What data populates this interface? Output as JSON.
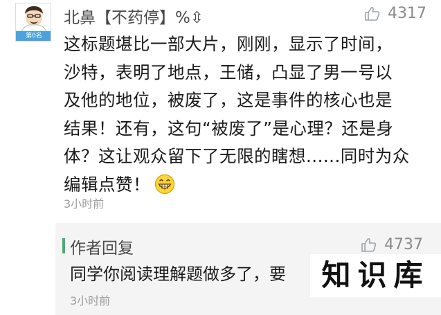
{
  "comment": {
    "avatar": {
      "rank_label": "第0名"
    },
    "username": "北鼻【不药停】%⇳",
    "likes": "4317",
    "lines": [
      "这标题堪比一部大片，刚刚，显示了时间，",
      "沙特，表明了地点，王储，凸显了男一号以",
      "及他的地位，被废了，这是事件的核心也是",
      "结果！还有，这句“被废了”是心理？还是身",
      "体？这让观众留下了无限的瞎想......同时为众",
      "编辑点赞！"
    ],
    "emoji": "grinning-face-icon",
    "time": "3小时前"
  },
  "reply": {
    "author": "作者回复",
    "likes": "4737",
    "text": "同学你阅读理解题做多了，要",
    "time": "3小时前"
  },
  "watermark": {
    "text": "知识库"
  },
  "colors": {
    "accent_green": "#3cb371",
    "avatar_blue": "#4aa3df",
    "meta_gray": "#9b9b9b",
    "reply_bg": "#f4f4f4"
  }
}
